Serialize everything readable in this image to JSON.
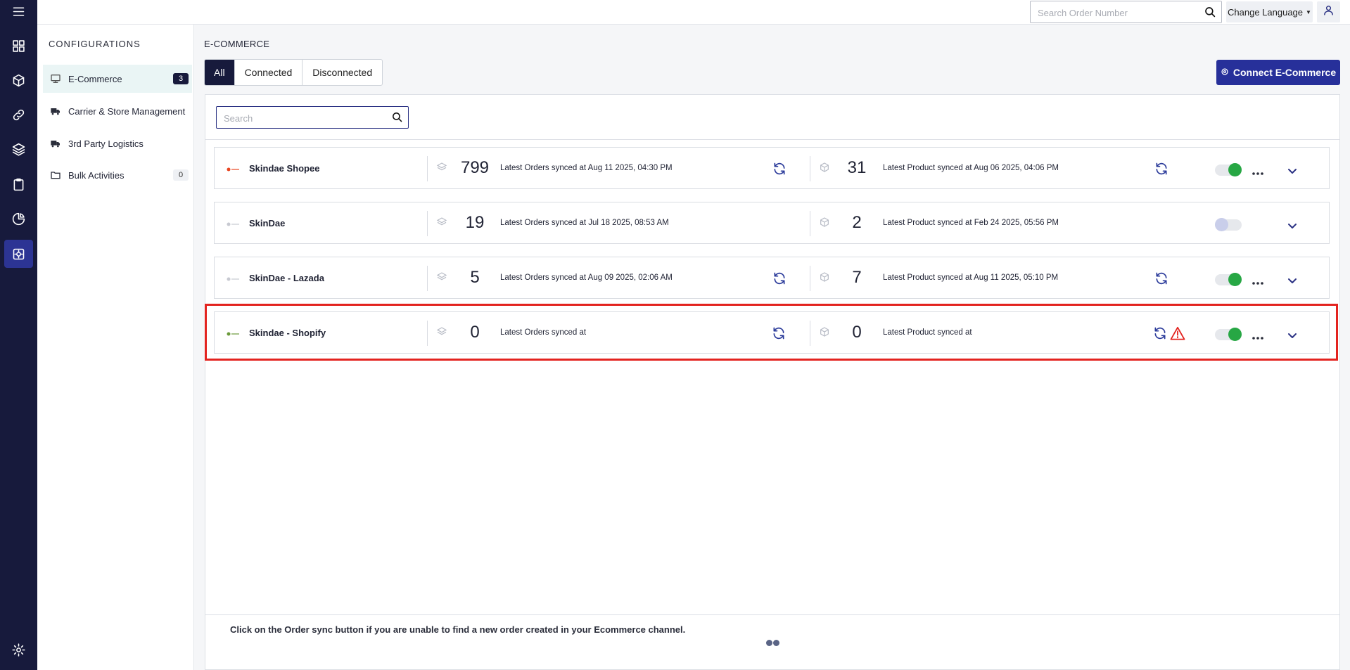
{
  "topbar": {
    "search_placeholder": "Search Order Number",
    "language_label": "Change Language",
    "icons": [
      "search-icon",
      "user-icon",
      "caret-down-icon"
    ]
  },
  "rail": {
    "items": [
      "menu-icon",
      "dashboard-icon",
      "box-icon",
      "link-icon",
      "layers-icon",
      "clipboard-icon",
      "pie-chart-icon",
      "settings-active-icon",
      "gear-icon"
    ]
  },
  "config": {
    "title": "CONFIGURATIONS",
    "items": [
      {
        "label": "E-Commerce",
        "badge": "3",
        "icon": "ecommerce-icon"
      },
      {
        "label": "Carrier & Store Management",
        "icon": "truck-icon"
      },
      {
        "label": "3rd Party Logistics",
        "icon": "truck-icon"
      },
      {
        "label": "Bulk Activities",
        "badge": "0",
        "icon": "folder-icon"
      }
    ]
  },
  "main": {
    "title": "E-COMMERCE",
    "tabs": [
      "All",
      "Connected",
      "Disconnected"
    ],
    "active_tab": "All",
    "connect_label": "Connect E-Commerce",
    "search_placeholder": "Search",
    "footer_note": "Click on the Order sync button if you are unable to find a new order created in your Ecommerce channel."
  },
  "channels": [
    {
      "name": "Skindae Shopee",
      "orders": "799",
      "orders_synced": "Latest Orders synced at Aug 11 2025, 04:30 PM",
      "products": "31",
      "products_synced": "Latest Product synced at Aug 06 2025, 04:06 PM",
      "enabled": true,
      "warning": false,
      "logo_color": "#e9441f"
    },
    {
      "name": "SkinDae",
      "orders": "19",
      "orders_synced": "Latest Orders synced at Jul 18 2025, 08:53 AM",
      "products": "2",
      "products_synced": "Latest Product synced at Feb 24 2025, 05:56 PM",
      "enabled": false,
      "warning": false,
      "logo_color": "#c7c9d1"
    },
    {
      "name": "SkinDae - Lazada",
      "orders": "5",
      "orders_synced": "Latest Orders synced at Aug 09 2025, 02:06 AM",
      "products": "7",
      "products_synced": "Latest Product synced at Aug 11 2025, 05:10 PM",
      "enabled": true,
      "warning": false,
      "logo_color": "#c7c9d1"
    },
    {
      "name": "Skindae - Shopify",
      "orders": "0",
      "orders_synced": "Latest Orders synced at",
      "products": "0",
      "products_synced": "Latest Product synced at",
      "enabled": true,
      "warning": true,
      "logo_color": "#6b9a3a"
    }
  ],
  "colors": {
    "rail_bg": "#171a3c",
    "accent": "#27309a",
    "toggle_on": "#27a744",
    "warning": "#e3231f"
  }
}
